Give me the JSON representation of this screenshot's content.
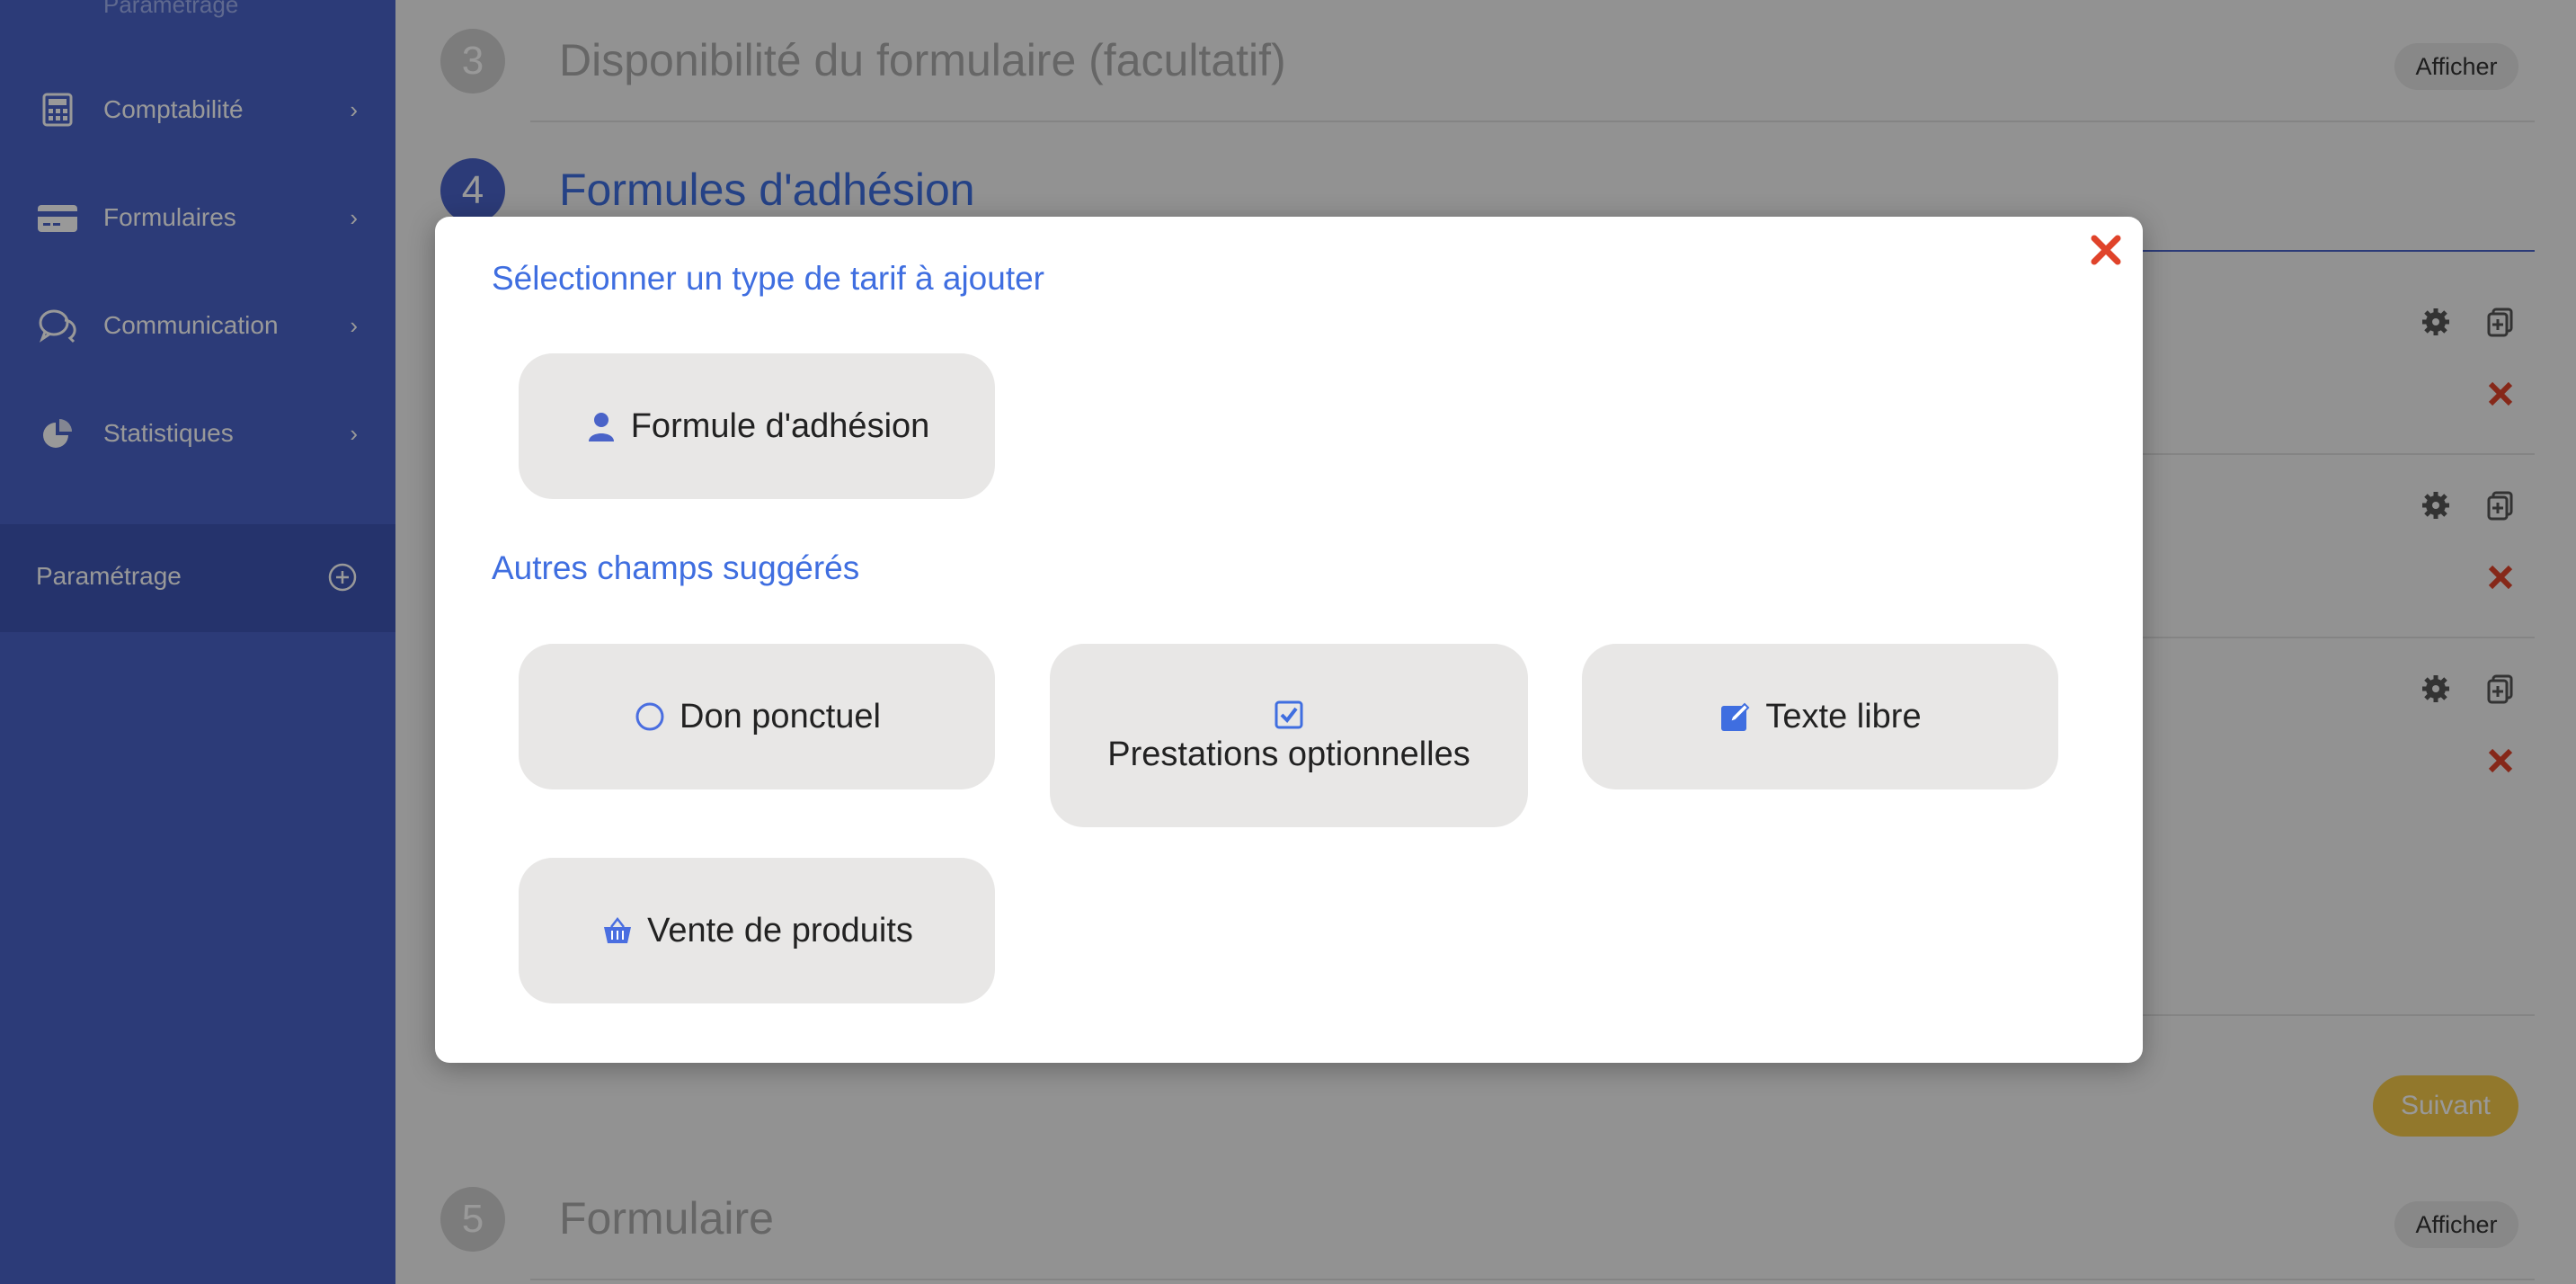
{
  "sidebar": {
    "top_partial_label": "Paramétrage",
    "items": [
      {
        "label": "Comptabilité",
        "icon": "calculator-icon"
      },
      {
        "label": "Formulaires",
        "icon": "card-icon"
      },
      {
        "label": "Communication",
        "icon": "chat-icon"
      },
      {
        "label": "Statistiques",
        "icon": "pie-chart-icon"
      }
    ],
    "parametrage": {
      "label": "Paramétrage",
      "icon": "plus-circle-icon"
    }
  },
  "main": {
    "steps": [
      {
        "number": "3",
        "title": "Disponibilité du formulaire (facultatif)",
        "button": "Afficher"
      },
      {
        "number": "4",
        "title": "Formules d'adhésion"
      },
      {
        "number": "5",
        "title": "Formulaire",
        "button": "Afficher"
      }
    ],
    "next_button": "Suivant"
  },
  "modal": {
    "title": "Sélectionner un type de tarif à ajouter",
    "primary_option": {
      "label": "Formule d'adhésion",
      "icon": "user-icon"
    },
    "suggested_title": "Autres champs suggérés",
    "suggested_options": [
      {
        "label": "Don ponctuel",
        "icon": "circle-icon"
      },
      {
        "label": "Prestations optionnelles",
        "icon": "checkbox-icon"
      },
      {
        "label": "Texte libre",
        "icon": "edit-icon"
      },
      {
        "label": "Vente de produits",
        "icon": "basket-icon"
      }
    ]
  },
  "colors": {
    "sidebar": "#4a63c8",
    "accent_blue": "#3f6ee0",
    "close_red": "#e0432a",
    "suivant_yellow": "#f3c84a"
  }
}
